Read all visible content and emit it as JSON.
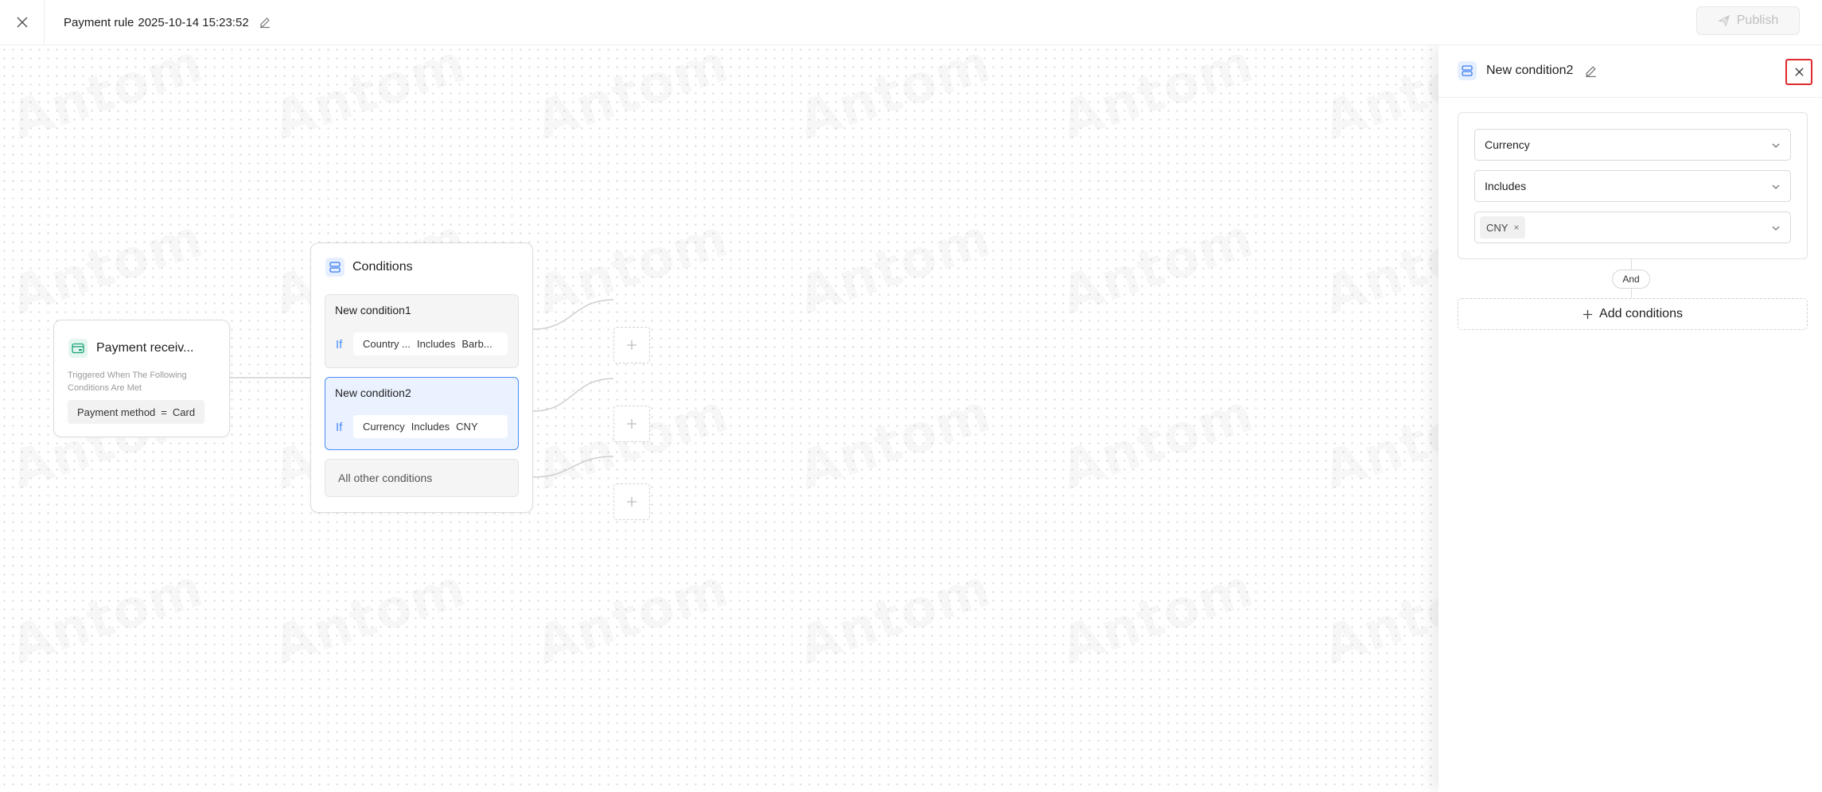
{
  "header": {
    "title_name": "Payment rule",
    "title_date": "2025-10-14 15:23:52",
    "publish_label": "Publish"
  },
  "canvas": {
    "watermark_text": "Antom",
    "trigger": {
      "title": "Payment receiv...",
      "description": "Triggered When The Following Conditions Are Met",
      "pill_field": "Payment method",
      "pill_eq": "=",
      "pill_value": "Card"
    },
    "conditions": {
      "title": "Conditions",
      "items": [
        {
          "name": "New condition1",
          "if_label": "If",
          "field": "Country ...",
          "operator": "Includes",
          "value": "Barb..."
        },
        {
          "name": "New condition2",
          "if_label": "If",
          "field": "Currency",
          "operator": "Includes",
          "value": "CNY"
        }
      ],
      "other_label": "All other conditions"
    }
  },
  "panel": {
    "title": "New condition2",
    "field_value": "Currency",
    "operator_value": "Includes",
    "selected_tags": [
      "CNY"
    ],
    "tag_remove": "×",
    "and_label": "And",
    "add_conditions_label": "Add conditions"
  },
  "colors": {
    "accent_blue": "#4b8cf5",
    "selected_bg": "#eaf2ff",
    "trigger_icon": "#1aa37a",
    "highlight_red": "#e0282e"
  },
  "icons": {
    "close": "close-icon",
    "edit": "edit-pencil-icon",
    "publish": "send-icon",
    "trigger": "payment-card-icon",
    "conditions": "conditions-stack-icon",
    "add": "plus-icon",
    "chevron": "chevron-down-icon"
  }
}
